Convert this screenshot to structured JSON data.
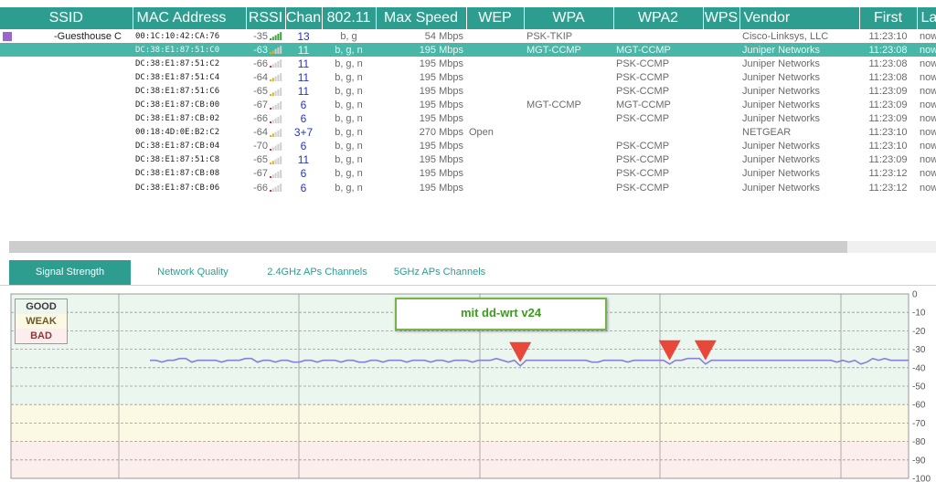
{
  "columns": [
    "SSID",
    "MAC Address",
    "RSSI",
    "Chan",
    "802.11",
    "Max Speed",
    "WEP",
    "WPA",
    "WPA2",
    "WPS",
    "Vendor",
    "First",
    "Las"
  ],
  "rows": [
    {
      "ssid": "-Guesthouse C",
      "mac": "00:1C:10:42:CA:76",
      "rssi": "-35",
      "chan": "13",
      "std": "b, g",
      "speed": "54 Mbps",
      "wep": "",
      "wpa": "PSK-TKIP",
      "wpa2": "",
      "vendor": "Cisco-Linksys, LLC",
      "first": "11:23:10",
      "last": "now",
      "swatch": "#9966cc",
      "bars": 5,
      "sel": false
    },
    {
      "ssid": "",
      "mac": "DC:38:E1:87:51:C0",
      "rssi": "-63",
      "chan": "11",
      "std": "b, g, n",
      "speed": "195 Mbps",
      "wep": "",
      "wpa": "MGT-CCMP",
      "wpa2": "MGT-CCMP",
      "vendor": "Juniper Networks",
      "first": "11:23:08",
      "last": "now",
      "swatch": "",
      "bars": 2,
      "sel": true
    },
    {
      "ssid": "",
      "mac": "DC:38:E1:87:51:C2",
      "rssi": "-66",
      "chan": "11",
      "std": "b, g, n",
      "speed": "195 Mbps",
      "wep": "",
      "wpa": "",
      "wpa2": "PSK-CCMP",
      "vendor": "Juniper Networks",
      "first": "11:23:08",
      "last": "now",
      "swatch": "",
      "bars": 1,
      "sel": false
    },
    {
      "ssid": "",
      "mac": "DC:38:E1:87:51:C4",
      "rssi": "-64",
      "chan": "11",
      "std": "b, g, n",
      "speed": "195 Mbps",
      "wep": "",
      "wpa": "",
      "wpa2": "PSK-CCMP",
      "vendor": "Juniper Networks",
      "first": "11:23:08",
      "last": "now",
      "swatch": "",
      "bars": 2,
      "sel": false
    },
    {
      "ssid": "",
      "mac": "DC:38:E1:87:51:C6",
      "rssi": "-65",
      "chan": "11",
      "std": "b, g, n",
      "speed": "195 Mbps",
      "wep": "",
      "wpa": "",
      "wpa2": "PSK-CCMP",
      "vendor": "Juniper Networks",
      "first": "11:23:09",
      "last": "now",
      "swatch": "",
      "bars": 2,
      "sel": false
    },
    {
      "ssid": "",
      "mac": "DC:38:E1:87:CB:00",
      "rssi": "-67",
      "chan": "6",
      "std": "b, g, n",
      "speed": "195 Mbps",
      "wep": "",
      "wpa": "MGT-CCMP",
      "wpa2": "MGT-CCMP",
      "vendor": "Juniper Networks",
      "first": "11:23:09",
      "last": "now",
      "swatch": "",
      "bars": 1,
      "sel": false
    },
    {
      "ssid": "",
      "mac": "DC:38:E1:87:CB:02",
      "rssi": "-66",
      "chan": "6",
      "std": "b, g, n",
      "speed": "195 Mbps",
      "wep": "",
      "wpa": "",
      "wpa2": "PSK-CCMP",
      "vendor": "Juniper Networks",
      "first": "11:23:09",
      "last": "now",
      "swatch": "",
      "bars": 1,
      "sel": false
    },
    {
      "ssid": "",
      "mac": "00:18:4D:0E:B2:C2",
      "rssi": "-64",
      "chan": "3+7",
      "std": "b, g, n",
      "speed": "270 Mbps",
      "wep": "Open",
      "wpa": "",
      "wpa2": "",
      "vendor": "NETGEAR",
      "first": "11:23:10",
      "last": "now",
      "swatch": "",
      "bars": 2,
      "sel": false
    },
    {
      "ssid": "",
      "mac": "DC:38:E1:87:CB:04",
      "rssi": "-70",
      "chan": "6",
      "std": "b, g, n",
      "speed": "195 Mbps",
      "wep": "",
      "wpa": "",
      "wpa2": "PSK-CCMP",
      "vendor": "Juniper Networks",
      "first": "11:23:10",
      "last": "now",
      "swatch": "",
      "bars": 1,
      "sel": false
    },
    {
      "ssid": "",
      "mac": "DC:38:E1:87:51:C8",
      "rssi": "-65",
      "chan": "11",
      "std": "b, g, n",
      "speed": "195 Mbps",
      "wep": "",
      "wpa": "",
      "wpa2": "PSK-CCMP",
      "vendor": "Juniper Networks",
      "first": "11:23:09",
      "last": "now",
      "swatch": "",
      "bars": 2,
      "sel": false
    },
    {
      "ssid": "",
      "mac": "DC:38:E1:87:CB:08",
      "rssi": "-67",
      "chan": "6",
      "std": "b, g, n",
      "speed": "195 Mbps",
      "wep": "",
      "wpa": "",
      "wpa2": "PSK-CCMP",
      "vendor": "Juniper Networks",
      "first": "11:23:12",
      "last": "now",
      "swatch": "",
      "bars": 1,
      "sel": false
    },
    {
      "ssid": "",
      "mac": "DC:38:E1:87:CB:06",
      "rssi": "-66",
      "chan": "6",
      "std": "b, g, n",
      "speed": "195 Mbps",
      "wep": "",
      "wpa": "",
      "wpa2": "PSK-CCMP",
      "vendor": "Juniper Networks",
      "first": "11:23:12",
      "last": "now",
      "swatch": "",
      "bars": 1,
      "sel": false
    }
  ],
  "tabs": [
    "Signal Strength",
    "Network Quality",
    "2.4GHz APs Channels",
    "5GHz APs Channels"
  ],
  "legend": {
    "good": "GOOD",
    "weak": "WEAK",
    "bad": "BAD"
  },
  "annotation": "mit dd-wrt v24",
  "colors": {
    "header": "#2d9d8f",
    "selected": "#49b7a7",
    "line": "#8a7fd9",
    "marker": "#e8483a",
    "good_band": "#eaf6ee",
    "weak_band": "#fbf8e3",
    "bad_band": "#fdeeee"
  },
  "chart_data": {
    "type": "line",
    "ylim": [
      -100,
      0
    ],
    "yticks": [
      "0",
      "-10",
      "-20",
      "-30",
      "-40",
      "-50",
      "-60",
      "-70",
      "-80",
      "-90",
      "-100"
    ],
    "grid": true,
    "series": [
      {
        "values": [
          -36,
          -36,
          -37,
          -36,
          -36,
          -35,
          -35,
          -37,
          -36,
          -36,
          -36,
          -36,
          -37,
          -36,
          -36,
          -36,
          -35,
          -35,
          -37,
          -36,
          -36,
          -37,
          -36,
          -36,
          -37,
          -37,
          -36,
          -36,
          -37,
          -36,
          -36,
          -36,
          -37,
          -36,
          -36,
          -37,
          -37,
          -36,
          -36,
          -37,
          -36,
          -36,
          -36,
          -37,
          -36,
          -36,
          -36,
          -37,
          -36,
          -36,
          -37,
          -36,
          -36,
          -36,
          -37,
          -36,
          -36,
          -36,
          -35,
          -36,
          -37,
          -36,
          -39,
          -36,
          -36,
          -36,
          -36,
          -36,
          -36,
          -36,
          -36,
          -36,
          -36,
          -36,
          -37,
          -37,
          -36,
          -36,
          -36,
          -36,
          -37,
          -36,
          -36,
          -36,
          -36,
          -36,
          -36,
          -38,
          -36,
          -36,
          -35,
          -35,
          -35,
          -38,
          -36,
          -36,
          -36,
          -36,
          -36,
          -36,
          -36,
          -36,
          -36,
          -36,
          -36,
          -36,
          -36,
          -36,
          -36,
          -36,
          -36,
          -36,
          -36,
          -36,
          -36,
          -37,
          -36,
          -37,
          -36,
          -38,
          -37,
          -35,
          -36,
          -35,
          -36,
          -36,
          -36,
          -36
        ]
      }
    ],
    "markers_at_index": [
      62,
      87,
      93
    ]
  }
}
